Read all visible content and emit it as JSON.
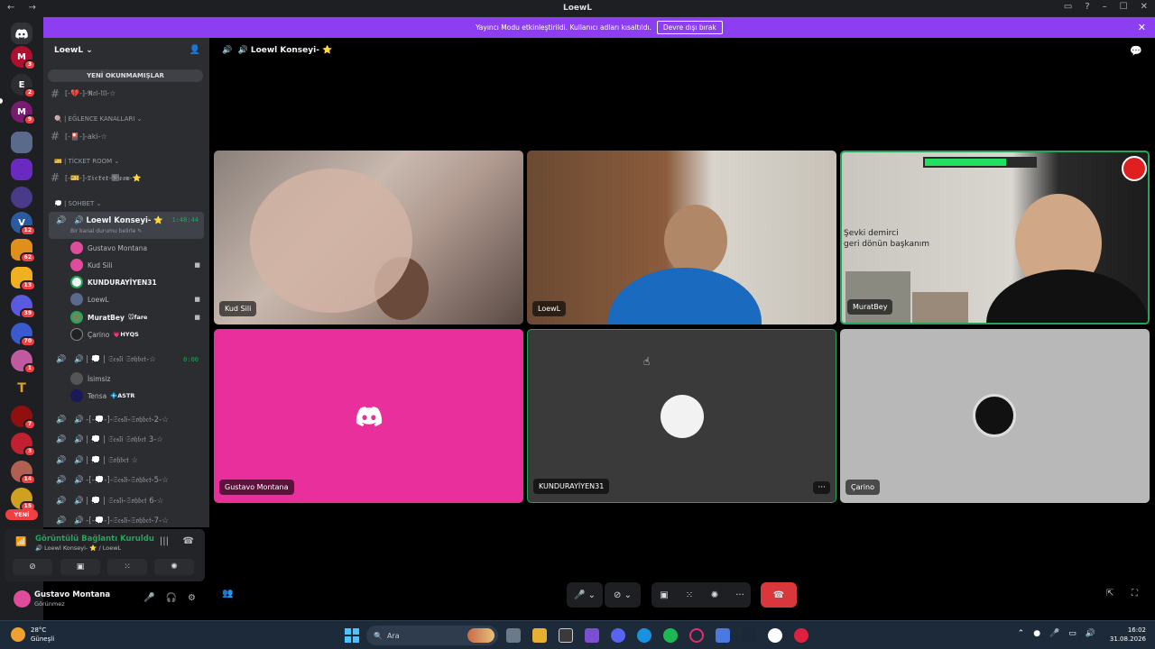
{
  "window": {
    "title": "LoewL"
  },
  "banner": {
    "text": "Yayıncı Modu etkinleştirildi. Kullanıcı adları kısaltıldı.",
    "button": "Devre dışı bırak"
  },
  "guilds": {
    "badges": [
      "3",
      "2",
      "9",
      "",
      "",
      "",
      "12",
      "62",
      "13",
      "39",
      "70",
      "1",
      "",
      "7",
      "3",
      "14",
      "15"
    ],
    "new_label": "YENİ"
  },
  "server": {
    "name": "LoewL",
    "unread": "YENİ OKUNMAMIŞLAR"
  },
  "channels": {
    "c1": "[-💔-]-𝕽𝔬𝔩-𝔘𝔩-☆",
    "cat_fun": "| EĞLENCE KANALLARI",
    "c2": "[-🎴-]-aki-☆",
    "cat_ticket": "| TİCKET ROOM",
    "c3": "[-🎫-]-𝔗𝔦𝔠𝔨𝔢𝔱-𝔕𝔬𝔬𝔪-⭐",
    "cat_sohbet": "| SOHBET",
    "v1": "Loewl Konseyi- ⭐",
    "v1_time": "1:48:44",
    "v1_status": "Bir kanal durumu belirle",
    "v2": "| 💭 | 𝔖𝔢𝔰𝔩𝔦 𝔖𝔬𝔥𝔟𝔢𝔱-☆",
    "v2_time": "0:00",
    "v3": "-[-💭-]-𝔖𝔢𝔰𝔩𝔦-𝔖𝔬𝔥𝔟𝔢𝔱-2-☆",
    "v4": "| 💭 | 𝔖𝔢𝔰𝔩𝔦 𝔖𝔬𝔥𝔟𝔢𝔱 3-☆",
    "v5": "| 💭 | 𝔖𝔬𝔥𝔟𝔢𝔱 ☆",
    "v6": "-[-💭-]-𝔖𝔢𝔰𝔩𝔦-𝔖𝔬𝔥𝔟𝔢𝔱-5-☆",
    "v7": "| 💭 | 𝔖𝔢𝔰𝔩𝔦-𝔖𝔬𝔥𝔟𝔢𝔱 6-☆",
    "v8": "-[-💭-]-𝔖𝔢𝔰𝔩𝔦-𝔖𝔬𝔥𝔟𝔢𝔱-7-☆"
  },
  "voice_users": [
    {
      "name": "Gustavo Montana",
      "tag": ""
    },
    {
      "name": "Kud Sili",
      "tag": ""
    },
    {
      "name": "KUNDURAYİYEN31",
      "tag": ""
    },
    {
      "name": "LoewL",
      "tag": ""
    },
    {
      "name": "MuratBey",
      "tag": "🐭fare"
    },
    {
      "name": "Çarino",
      "tag": "💗HYQS"
    },
    {
      "name": "İsimsiz",
      "tag": ""
    },
    {
      "name": "Tensa",
      "tag": "💠ASTR"
    }
  ],
  "voice_panel": {
    "status": "Görüntülü Bağlantı Kuruldu",
    "channel": "Loewl Konseyi- ⭐ / LoewL"
  },
  "user_panel": {
    "name": "Gustavo Montana",
    "status": "Görünmez"
  },
  "call": {
    "channel": "Loewl Konseyi- ⭐",
    "tiles": [
      "Kud Sili",
      "LoewL",
      "MuratBey",
      "Gustavo Montana",
      "KUNDURAYİYEN31",
      "Çarino"
    ],
    "murat_overlay": "Şevki demirci\ngeri dönün başkanım"
  },
  "taskbar": {
    "temp": "28°C",
    "weather": "Güneşli",
    "search": "Ara",
    "time": "16:02",
    "date": "31.08.2026"
  }
}
